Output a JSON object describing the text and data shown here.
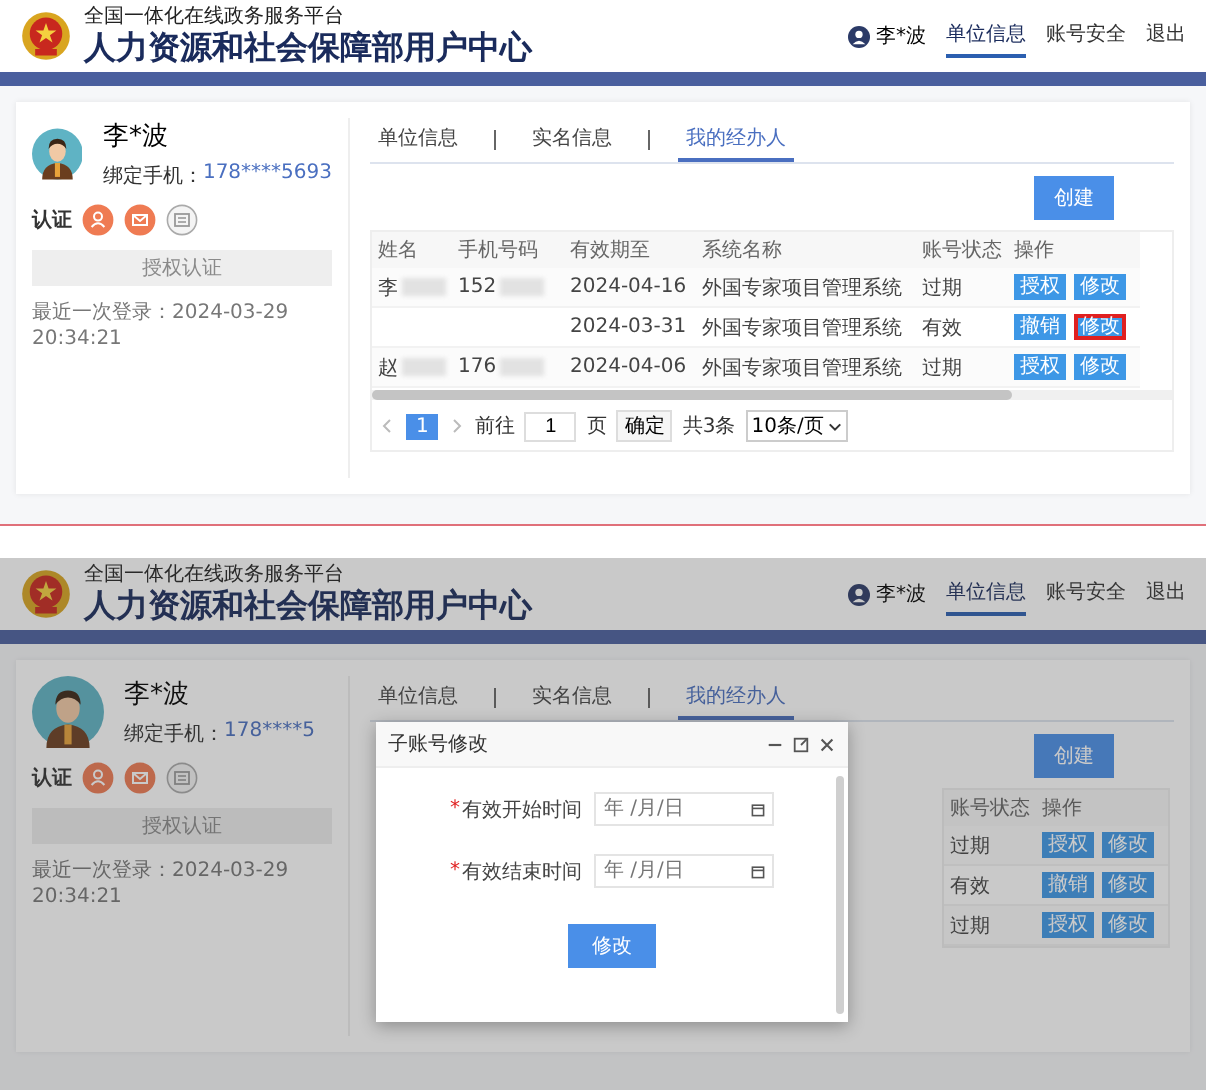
{
  "top": {
    "header": {
      "subtitle": "全国一体化在线政务服务平台",
      "title": "人力资源和社会保障部用户中心",
      "user": "李*波",
      "nav": [
        {
          "label": "单位信息",
          "selected": true
        },
        {
          "label": "账号安全",
          "selected": false
        },
        {
          "label": "退出",
          "selected": false
        }
      ]
    },
    "profile": {
      "name": "李*波",
      "phone_label": "绑定手机：",
      "phone": "178****5693",
      "cert_label": "认证",
      "certs": [
        {
          "kind": "person",
          "verified": true
        },
        {
          "kind": "mail",
          "verified": true
        },
        {
          "kind": "card",
          "verified": false
        }
      ],
      "auth_button": "授权认证",
      "last_login": "最近一次登录：2024-03-29 20:34:21"
    },
    "tabs": [
      {
        "label": "单位信息",
        "selected": false
      },
      {
        "label": "实名信息",
        "selected": false
      },
      {
        "label": "我的经办人",
        "selected": true
      }
    ],
    "create_button": "创建",
    "table": {
      "columns": [
        "姓名",
        "手机号码",
        "有效期至",
        "系统名称",
        "账号状态",
        "操作"
      ],
      "rows": [
        {
          "name": {
            "text": "李",
            "redacted": true
          },
          "phone": {
            "text": "152",
            "redacted": true
          },
          "expiry": "2024-04-16",
          "system": "外国专家项目管理系统",
          "status": "过期",
          "actions": [
            {
              "label": "授权",
              "highlighted": false
            },
            {
              "label": "修改",
              "highlighted": false
            }
          ]
        },
        {
          "expiry": "2024-03-31",
          "system": "外国专家项目管理系统",
          "status": "有效",
          "actions": [
            {
              "label": "撤销",
              "highlighted": false
            },
            {
              "label": "修改",
              "highlighted": true
            }
          ]
        },
        {
          "name": {
            "text": "赵",
            "redacted": true
          },
          "phone": {
            "text": "176",
            "redacted": true
          },
          "expiry": "2024-04-06",
          "system": "外国专家项目管理系统",
          "status": "过期",
          "actions": [
            {
              "label": "授权",
              "highlighted": false
            },
            {
              "label": "修改",
              "highlighted": false
            }
          ]
        }
      ]
    },
    "pagination": {
      "pages": [
        {
          "label": "1",
          "selected": true
        }
      ],
      "goto_label": "前往",
      "goto_value": "1",
      "page_unit": "页",
      "confirm": "确定",
      "total": "共3条",
      "page_size": "10条/页"
    }
  },
  "bottom": {
    "header": {
      "subtitle": "全国一体化在线政务服务平台",
      "title": "人力资源和社会保障部用户中心",
      "user": "李*波",
      "nav": [
        {
          "label": "单位信息",
          "selected": true
        },
        {
          "label": "账号安全",
          "selected": false
        },
        {
          "label": "退出",
          "selected": false
        }
      ]
    },
    "profile": {
      "name": "李*波",
      "phone_label": "绑定手机：",
      "phone": "178****5",
      "cert_label": "认证",
      "certs": [
        {
          "kind": "person",
          "verified": true
        },
        {
          "kind": "mail",
          "verified": true
        },
        {
          "kind": "card",
          "verified": false
        }
      ],
      "auth_button": "授权认证",
      "last_login": "最近一次登录：2024-03-29 20:34:21"
    },
    "tabs": [
      {
        "label": "单位信息",
        "selected": false
      },
      {
        "label": "实名信息",
        "selected": false
      },
      {
        "label": "我的经办人",
        "selected": true
      }
    ],
    "create_button": "创建",
    "table": {
      "columns": [
        "账号状态",
        "操作"
      ],
      "rows": [
        {
          "status": "过期",
          "actions": [
            {
              "label": "授权",
              "highlighted": false
            },
            {
              "label": "修改",
              "highlighted": false
            }
          ]
        },
        {
          "status": "有效",
          "actions": [
            {
              "label": "撤销",
              "highlighted": false
            },
            {
              "label": "修改",
              "highlighted": false
            }
          ]
        },
        {
          "status": "过期",
          "actions": [
            {
              "label": "授权",
              "highlighted": false
            },
            {
              "label": "修改",
              "highlighted": false
            }
          ]
        }
      ]
    },
    "dialog": {
      "title": "子账号修改",
      "fields": [
        {
          "required_mark": "*",
          "label": "有效开始时间",
          "placeholder": "年 /月/日"
        },
        {
          "required_mark": "*",
          "label": "有效结束时间",
          "placeholder": "年 /月/日"
        }
      ],
      "submit": "修改"
    }
  }
}
